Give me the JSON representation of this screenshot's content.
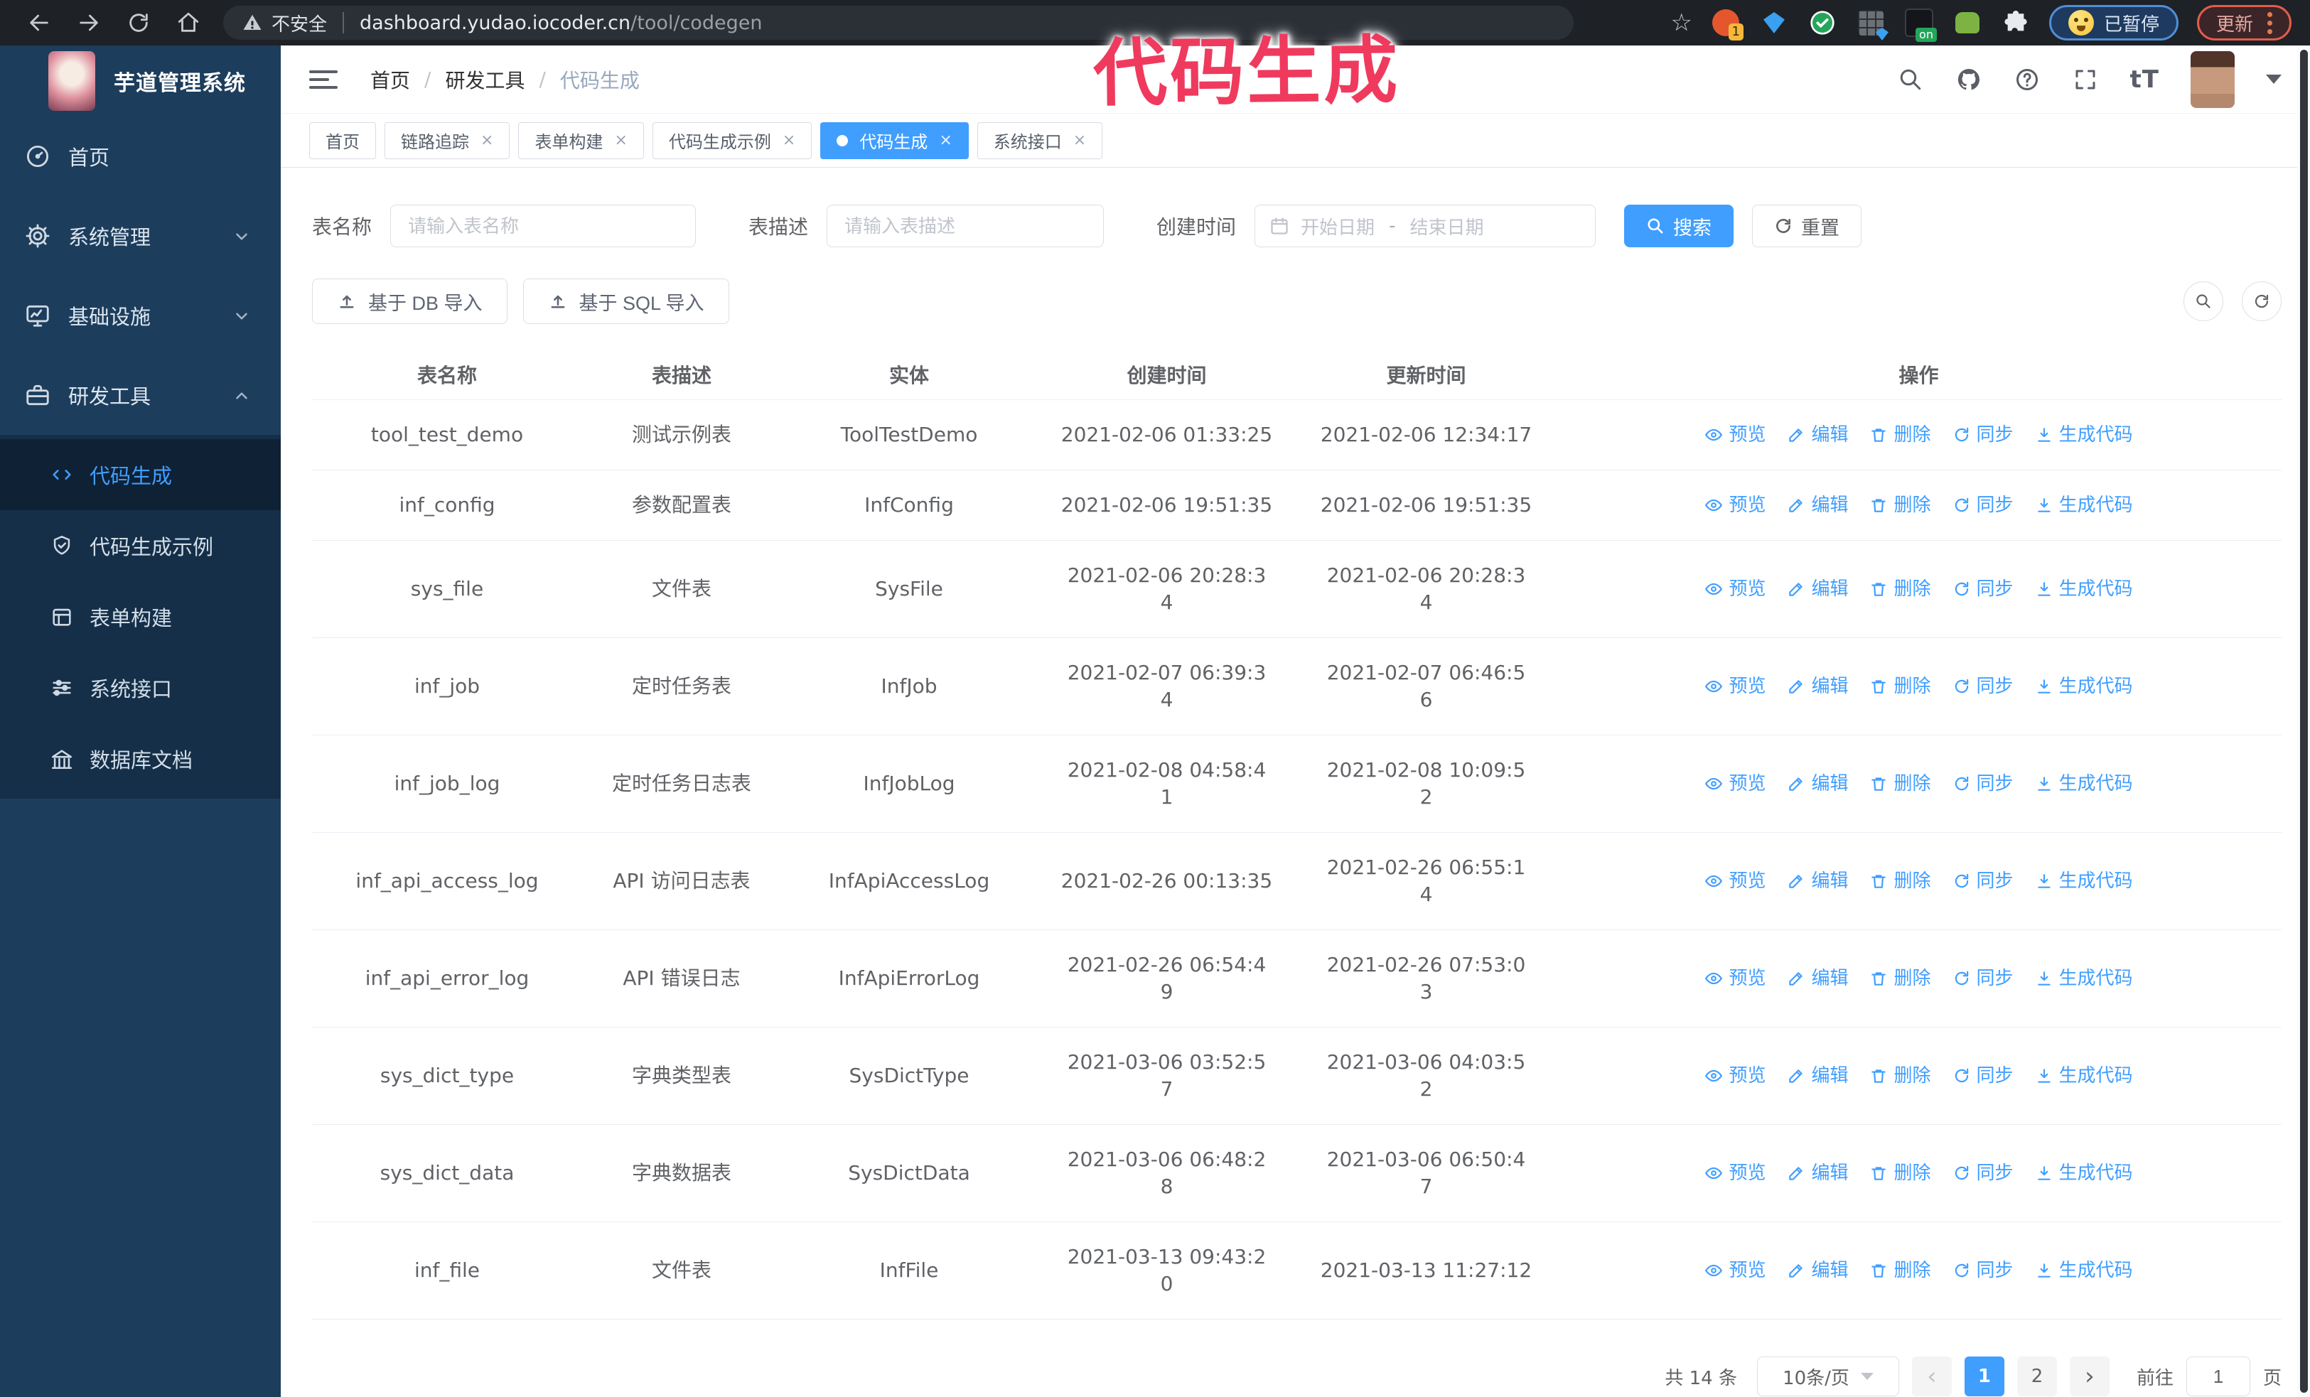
{
  "browser": {
    "security_label": "不安全",
    "url_host": "dashboard.yudao.iocoder.cn",
    "url_path": "/tool/codegen",
    "paused_chip": "已暂停",
    "update_chip": "更新",
    "icons": [
      "back-icon",
      "forward-icon",
      "reload-icon",
      "home-icon",
      "warning-icon",
      "bookmark-star-icon",
      "extension-icons",
      "browser-menu-dots-icon"
    ]
  },
  "annotation": {
    "text": "代码生成",
    "color": "#ef3a5e"
  },
  "sidebar": {
    "logo_title": "芋道管理系统",
    "items": [
      {
        "label": "首页",
        "icon": "dashboard-icon",
        "chevron": ""
      },
      {
        "label": "系统管理",
        "icon": "gear-icon",
        "chevron": "down"
      },
      {
        "label": "基础设施",
        "icon": "monitor-icon",
        "chevron": "down"
      },
      {
        "label": "研发工具",
        "icon": "toolbox-icon",
        "chevron": "up"
      }
    ],
    "submenu": [
      {
        "label": "代码生成",
        "icon": "code-icon",
        "active": true
      },
      {
        "label": "代码生成示例",
        "icon": "shield-check-icon",
        "active": false
      },
      {
        "label": "表单构建",
        "icon": "form-icon",
        "active": false
      },
      {
        "label": "系统接口",
        "icon": "sliders-icon",
        "active": false
      },
      {
        "label": "数据库文档",
        "icon": "database-icon",
        "active": false
      }
    ]
  },
  "topbar": {
    "breadcrumb": [
      "首页",
      "研发工具",
      "代码生成"
    ],
    "right_icons": [
      "search-icon",
      "github-icon",
      "help-icon",
      "fullscreen-icon",
      "font-size-icon",
      "avatar",
      "chevron-down-icon"
    ],
    "font_size_glyph": "tT"
  },
  "tabs": [
    {
      "label": "首页",
      "closable": false,
      "active": false
    },
    {
      "label": "链路追踪",
      "closable": true,
      "active": false
    },
    {
      "label": "表单构建",
      "closable": true,
      "active": false
    },
    {
      "label": "代码生成示例",
      "closable": true,
      "active": false
    },
    {
      "label": "代码生成",
      "closable": true,
      "active": true
    },
    {
      "label": "系统接口",
      "closable": true,
      "active": false
    }
  ],
  "filters": {
    "name_label": "表名称",
    "name_placeholder": "请输入表名称",
    "desc_label": "表描述",
    "desc_placeholder": "请输入表描述",
    "time_label": "创建时间",
    "start_placeholder": "开始日期",
    "end_placeholder": "结束日期",
    "range_separator": "-",
    "search_label": "搜索",
    "reset_label": "重置"
  },
  "toolbar": {
    "import_db_label": "基于 DB 导入",
    "import_sql_label": "基于 SQL 导入",
    "icons": [
      "upload-icon",
      "search-circle-button",
      "refresh-circle-button"
    ]
  },
  "table": {
    "columns": [
      "表名称",
      "表描述",
      "实体",
      "创建时间",
      "更新时间",
      "操作"
    ],
    "actions": [
      {
        "label": "预览",
        "icon": "eye-icon"
      },
      {
        "label": "编辑",
        "icon": "edit-icon"
      },
      {
        "label": "删除",
        "icon": "trash-icon"
      },
      {
        "label": "同步",
        "icon": "sync-icon"
      },
      {
        "label": "生成代码",
        "icon": "download-icon"
      }
    ],
    "rows": [
      {
        "name": "tool_test_demo",
        "desc": "测试示例表",
        "entity": "ToolTestDemo",
        "created": "2021-02-06 01:33:25",
        "updated": "2021-02-06 12:34:17"
      },
      {
        "name": "inf_config",
        "desc": "参数配置表",
        "entity": "InfConfig",
        "created": "2021-02-06 19:51:35",
        "updated": "2021-02-06 19:51:35"
      },
      {
        "name": "sys_file",
        "desc": "文件表",
        "entity": "SysFile",
        "created": "2021-02-06 20:28:3\n4",
        "updated": "2021-02-06 20:28:3\n4"
      },
      {
        "name": "inf_job",
        "desc": "定时任务表",
        "entity": "InfJob",
        "created": "2021-02-07 06:39:3\n4",
        "updated": "2021-02-07 06:46:5\n6"
      },
      {
        "name": "inf_job_log",
        "desc": "定时任务日志表",
        "entity": "InfJobLog",
        "created": "2021-02-08 04:58:4\n1",
        "updated": "2021-02-08 10:09:5\n2"
      },
      {
        "name": "inf_api_access_log",
        "desc": "API 访问日志表",
        "entity": "InfApiAccessLog",
        "created": "2021-02-26 00:13:35",
        "updated": "2021-02-26 06:55:1\n4"
      },
      {
        "name": "inf_api_error_log",
        "desc": "API 错误日志",
        "entity": "InfApiErrorLog",
        "created": "2021-02-26 06:54:4\n9",
        "updated": "2021-02-26 07:53:0\n3"
      },
      {
        "name": "sys_dict_type",
        "desc": "字典类型表",
        "entity": "SysDictType",
        "created": "2021-03-06 03:52:5\n7",
        "updated": "2021-03-06 04:03:5\n2"
      },
      {
        "name": "sys_dict_data",
        "desc": "字典数据表",
        "entity": "SysDictData",
        "created": "2021-03-06 06:48:2\n8",
        "updated": "2021-03-06 06:50:4\n7"
      },
      {
        "name": "inf_file",
        "desc": "文件表",
        "entity": "InfFile",
        "created": "2021-03-13 09:43:2\n0",
        "updated": "2021-03-13 11:27:12"
      }
    ]
  },
  "pagination": {
    "total_label": "共 14 条",
    "page_size_label": "10条/页",
    "prev_glyph": "‹",
    "next_glyph": "›",
    "pages": [
      "1",
      "2"
    ],
    "active_page": "1",
    "goto_label": "前往",
    "goto_value": "1",
    "page_suffix": "页"
  },
  "colors": {
    "accent": "#409eff",
    "sidebar_bg": "#1d3d5c",
    "submenu_bg": "#152f49",
    "annotation_pink": "#ef3a5e",
    "active_tab": "#409eff"
  }
}
